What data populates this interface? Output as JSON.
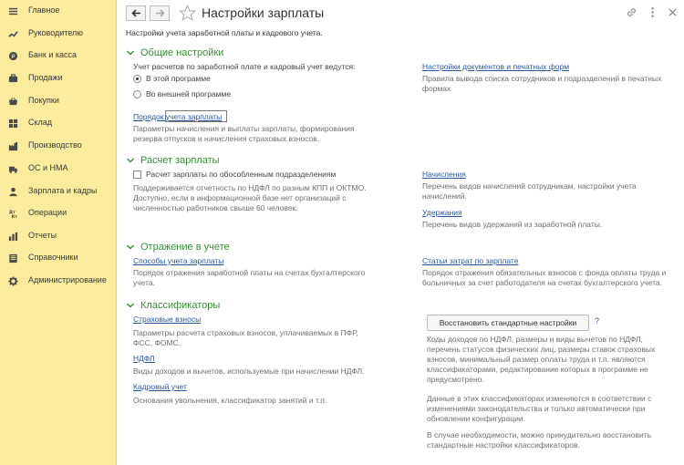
{
  "sidebar": {
    "items": [
      {
        "label": "Главное",
        "icon": "menu-icon"
      },
      {
        "label": "Руководителю",
        "icon": "trend-icon"
      },
      {
        "label": "Банк и касса",
        "icon": "coin-icon"
      },
      {
        "label": "Продажи",
        "icon": "cart-icon"
      },
      {
        "label": "Покупки",
        "icon": "basket-icon"
      },
      {
        "label": "Склад",
        "icon": "grid-icon"
      },
      {
        "label": "Производство",
        "icon": "factory-icon"
      },
      {
        "label": "ОС и НМА",
        "icon": "truck-icon"
      },
      {
        "label": "Зарплата и кадры",
        "icon": "person-icon"
      },
      {
        "label": "Операции",
        "icon": "operations-icon"
      },
      {
        "label": "Отчеты",
        "icon": "chart-icon"
      },
      {
        "label": "Справочники",
        "icon": "book-icon"
      },
      {
        "label": "Администрирование",
        "icon": "gear-icon"
      }
    ]
  },
  "header": {
    "title": "Настройки зарплаты",
    "subtitle": "Настройки учета заработной платы и кадрового учета."
  },
  "general": {
    "title": "Общие настройки",
    "question": "Учет расчетов по заработной плате и кадровый учет ведутся:",
    "radio_in_program": "В этой программе",
    "radio_external": "Во внешней программе",
    "payroll_link": "Порядок учета зарплаты",
    "payroll_desc": "Параметры начисления и выплаты зарплаты, формирования резерва отпусков и начисления страховых взносов.",
    "docs_link": "Настройки документов и печатных форм",
    "docs_desc": "Правила вывода списка сотрудников и подразделений в печатных формах"
  },
  "calc": {
    "title": "Расчет зарплаты",
    "separate_label": "Расчет зарплаты по обособленным подразделениям",
    "separate_desc": "Поддерживается отчетность по НДФЛ по разным КПП и ОКТМО. Доступно, если в информационной базе нет организаций с численностью работников свыше 60 человек.",
    "accruals_link": "Начисления",
    "accruals_desc": "Перечень видов начислений сотрудникам, настройки учета начислений.",
    "deductions_link": "Удержания",
    "deductions_desc": "Перечень видов удержаний из заработной платы."
  },
  "accounting": {
    "title": "Отражение в учете",
    "methods_link": "Способы учета зарплаты",
    "methods_desc": "Порядок отражения заработной платы на счетах бухгалтерского учета.",
    "costs_link": "Статьи затрат по зарплате",
    "costs_desc": "Порядок отражения обязательных взносов с фонда оплаты труда и больничных за счет работодателя на счетах бухгалтерского учета."
  },
  "classifiers": {
    "title": "Классификаторы",
    "insurance_link": "Страховые взносы",
    "insurance_desc": "Параметры расчета страховых взносов, уплачиваемых в ПФР, ФСС, ФОМС.",
    "ndfl_link": "НДФЛ",
    "ndfl_desc": "Виды доходов и вычетов, используемые при начислении НДФЛ.",
    "hr_link": "Кадровый учет",
    "hr_desc": "Основания увольнения, классификатор занятий и т.п.",
    "restore_button": "Восстановить стандартные настройки",
    "help_mark": "?",
    "note1": "Коды доходов по НДФЛ, размеры и виды вычетов по НДФЛ, перечень статусов физических лиц, размеры ставок страховых взносов, минимальный размер оплаты труда и т.п. являются классификаторами, редактирование которых в программе не предусмотрено.",
    "note2": "Данные в этих классификаторах изменяются в соответствии с изменениями законодательства и только автоматически при обновлении конфигурации.",
    "note3": "В случае необходимости, можно принудительно восстановить стандартные настройки классификаторов."
  },
  "colors": {
    "sidebar_bg": "#fbec9d",
    "section_title": "#3a8b3a",
    "link": "#2b5aa0"
  }
}
